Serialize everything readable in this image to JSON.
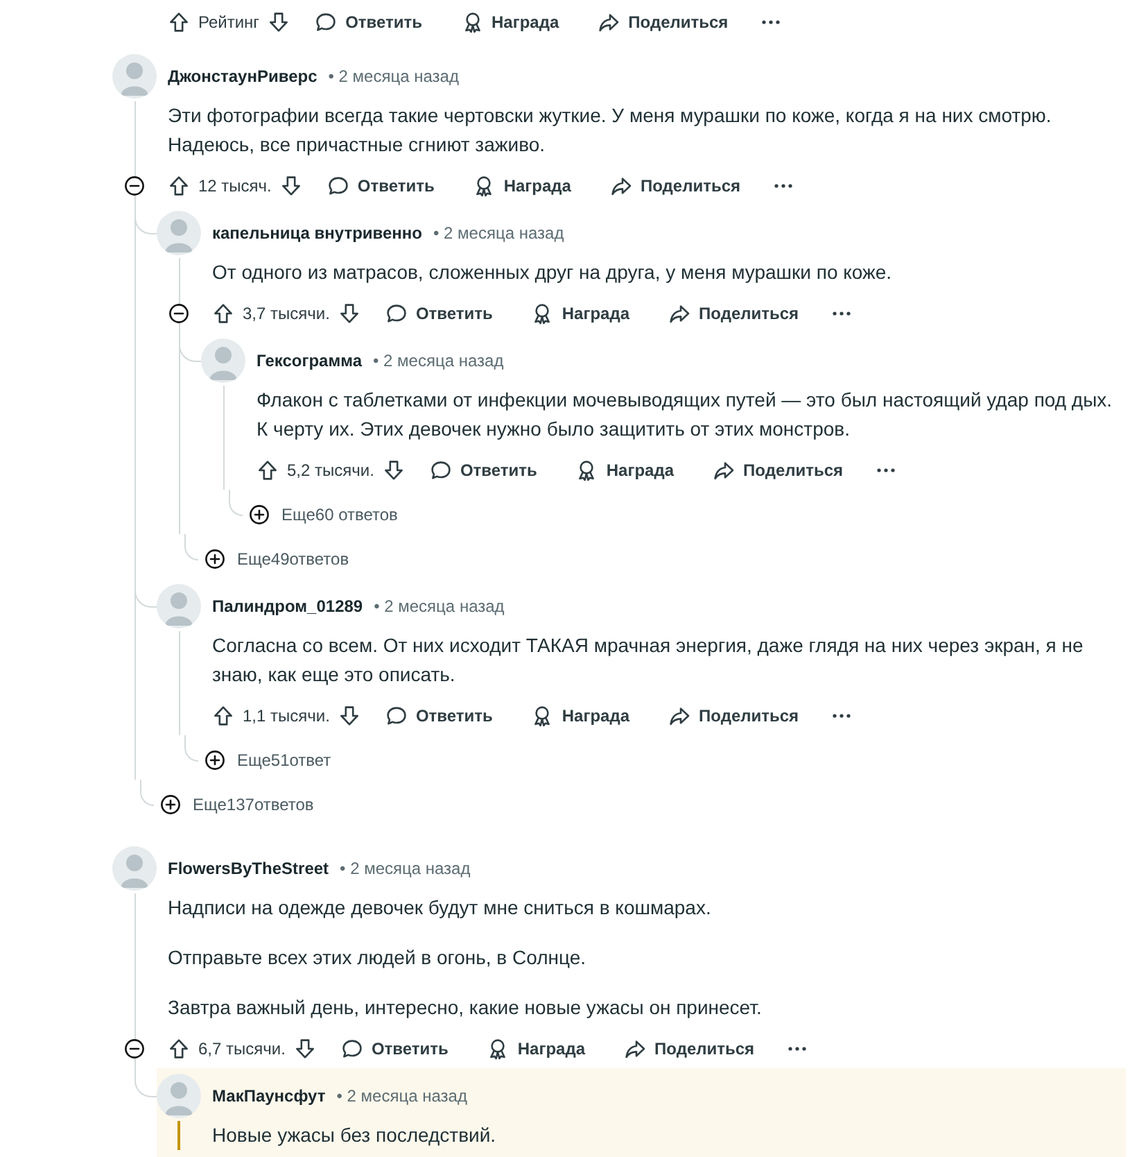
{
  "previous_comment_actions": {
    "vote": "Рейтинг",
    "reply": "Ответить",
    "award": "Награда",
    "share": "Поделиться"
  },
  "comments": [
    {
      "author": "ДжонстаунРиверс",
      "time": "• 2 месяца назад",
      "paragraphs": [
        "Эти фотографии всегда такие чертовски жуткие. У меня мурашки по коже, когда я на них смотрю. Надеюсь, все причастные сгниют заживо."
      ],
      "collapsible": true,
      "highlighted": false,
      "actions": {
        "vote": "12 тысяч.",
        "reply": "Ответить",
        "award": "Награда",
        "share": "Поделиться"
      },
      "children": [
        {
          "author": "капельница внутривенно",
          "time": "• 2 месяца назад",
          "paragraphs": [
            "От одного из матрасов, сложенных друг на друга, у меня мурашки по коже."
          ],
          "collapsible": true,
          "highlighted": false,
          "actions": {
            "vote": "3,7 тысячи.",
            "reply": "Ответить",
            "award": "Награда",
            "share": "Поделиться"
          },
          "children": [
            {
              "author": "Гексограмма",
              "time": "• 2 месяца назад",
              "paragraphs": [
                "Флакон с таблетками от инфекции мочевыводящих путей — это был настоящий удар под дых. К черту их. Этих девочек нужно было защитить от этих монстров."
              ],
              "collapsible": false,
              "highlighted": false,
              "actions": {
                "vote": "5,2 тысячи.",
                "reply": "Ответить",
                "award": "Награда",
                "share": "Поделиться"
              },
              "more_replies": "Еще60 ответов"
            }
          ],
          "more_replies": "Еще49ответов"
        },
        {
          "author": "Палиндром_01289",
          "time": "• 2 месяца назад",
          "paragraphs": [
            "Согласна со всем. От них исходит ТАКАЯ мрачная энергия, даже глядя на них через экран, я не знаю, как еще это описать."
          ],
          "collapsible": false,
          "highlighted": false,
          "actions": {
            "vote": "1,1 тысячи.",
            "reply": "Ответить",
            "award": "Награда",
            "share": "Поделиться"
          },
          "more_replies": "Еще51ответ"
        }
      ],
      "more_replies": "Еще137ответов"
    },
    {
      "author": "FlowersByTheStreet",
      "time": "• 2 месяца назад",
      "paragraphs": [
        "Надписи на одежде девочек будут мне сниться в кошмарах.",
        "Отправьте всех этих людей в огонь, в Солнце.",
        "Завтра важный день, интересно, какие новые ужасы он принесет."
      ],
      "collapsible": true,
      "highlighted": false,
      "actions": {
        "vote": "6,7 тысячи.",
        "reply": "Ответить",
        "award": "Награда",
        "share": "Поделиться"
      },
      "children": [
        {
          "author": "МакПаунсфут",
          "time": "• 2 месяца назад",
          "paragraphs": [
            "Новые ужасы без последствий."
          ],
          "collapsible": false,
          "highlighted": true
        }
      ]
    }
  ]
}
